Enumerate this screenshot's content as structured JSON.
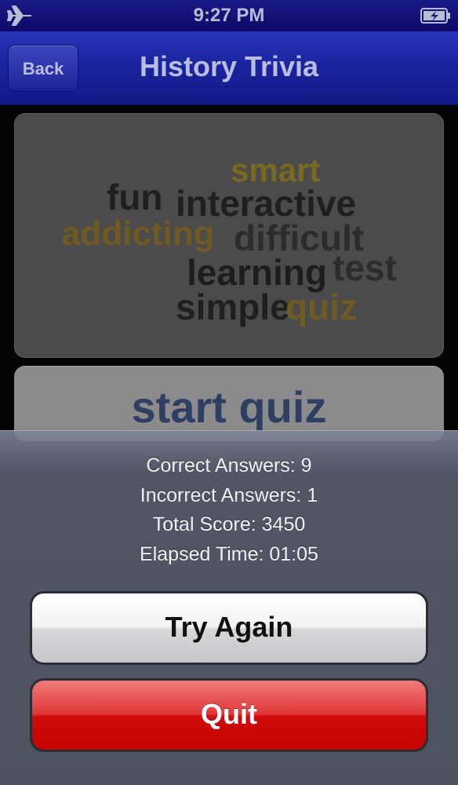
{
  "status_bar": {
    "time": "9:27 PM",
    "airplane_icon": "airplane-icon",
    "battery_icon": "battery-charging-icon"
  },
  "nav": {
    "back_label": "Back",
    "title": "History Trivia"
  },
  "word_cloud": {
    "words": [
      {
        "text": "smart",
        "color": "#7a6a20"
      },
      {
        "text": "fun",
        "color": "#1f1f1f"
      },
      {
        "text": "interactive",
        "color": "#1f1f1f"
      },
      {
        "text": "addicting",
        "color": "#6e5a22"
      },
      {
        "text": "difficult",
        "color": "#2c2c2c"
      },
      {
        "text": "learning",
        "color": "#1d1d1d"
      },
      {
        "text": "test",
        "color": "#2c2c2c"
      },
      {
        "text": "simple",
        "color": "#1f1f1f"
      },
      {
        "text": "quiz",
        "color": "#6e5a22"
      }
    ]
  },
  "start_quiz_label": "start quiz",
  "results": {
    "correct": "Correct Answers: 9",
    "incorrect": "Incorrect Answers: 1",
    "score": "Total Score: 3450",
    "elapsed": "Elapsed Time: 01:05"
  },
  "buttons": {
    "try_again": "Try Again",
    "quit": "Quit"
  },
  "colors": {
    "nav_bar": "#1b24a0",
    "quit_red": "#d30000",
    "sheet_bg": "#50535f"
  }
}
